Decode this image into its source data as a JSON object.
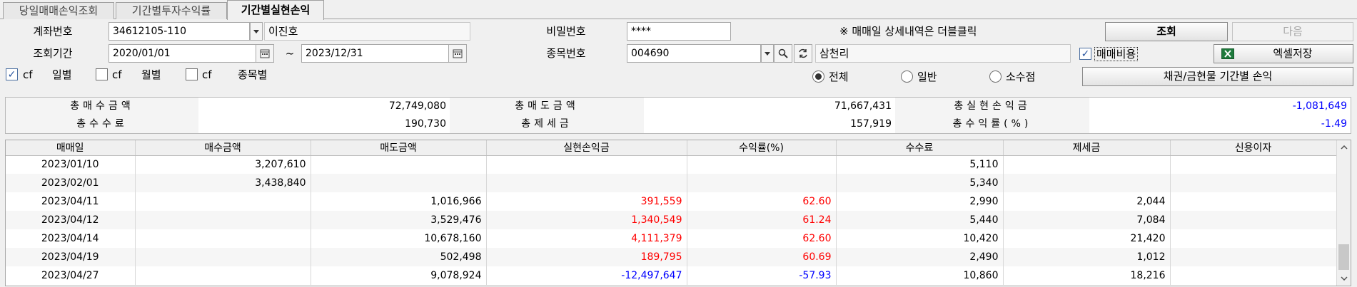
{
  "tabs": [
    {
      "label": "당일매매손익조회"
    },
    {
      "label": "기간별투자수익률"
    },
    {
      "label": "기간별실현손익"
    }
  ],
  "form": {
    "account_label": "계좌번호",
    "account_value": "34612105-110",
    "account_name": "이진호",
    "password_label": "비밀번호",
    "password_value": "****",
    "notice": "※ 매매일 상세내역은 더블클릭",
    "period_label": "조회기간",
    "date_from": "2020/01/01",
    "tilde": "~",
    "date_to": "2023/12/31",
    "stock_label": "종목번호",
    "stock_code": "004690",
    "stock_name": "삼천리",
    "cost_check_label": "매매비용",
    "chk_daily_prefix": "cf",
    "chk_daily_label": "일별",
    "chk_monthly_prefix": "cf",
    "chk_monthly_label": "월별",
    "chk_stock_prefix": "cf",
    "chk_stock_label": "종목별",
    "radio_all": "전체",
    "radio_normal": "일반",
    "radio_fraction": "소수점"
  },
  "buttons": {
    "query": "조회",
    "next": "다음",
    "excel": "엑셀저장",
    "bond": "채권/금현물 기간별 손익"
  },
  "summary": {
    "buy_label": "총매수금액",
    "buy_value": "72,749,080",
    "sell_label": "총매도금액",
    "sell_value": "71,667,431",
    "realized_label": "총실현손익금",
    "realized_value": "-1,081,649",
    "fee_label": "총수수료",
    "fee_value": "190,730",
    "tax_label": "총제세금",
    "tax_value": "157,919",
    "yield_label": "총수익률(%)",
    "yield_value": "-1.49"
  },
  "table": {
    "columns": [
      "매매일",
      "매수금액",
      "매도금액",
      "실현손익금",
      "수익률(%)",
      "수수료",
      "제세금",
      "신용이자"
    ],
    "rows": [
      [
        "2023/01/10",
        "3,207,610",
        "",
        "",
        "",
        "5,110",
        "",
        ""
      ],
      [
        "2023/02/01",
        "3,438,840",
        "",
        "",
        "",
        "5,340",
        "",
        ""
      ],
      [
        "2023/04/11",
        "",
        "1,016,966",
        "391,559",
        "62.60",
        "2,990",
        "2,044",
        ""
      ],
      [
        "2023/04/12",
        "",
        "3,529,476",
        "1,340,549",
        "61.24",
        "5,440",
        "7,084",
        ""
      ],
      [
        "2023/04/14",
        "",
        "10,678,160",
        "4,111,379",
        "62.60",
        "10,420",
        "21,420",
        ""
      ],
      [
        "2023/04/19",
        "",
        "502,498",
        "189,795",
        "60.69",
        "2,490",
        "1,012",
        ""
      ],
      [
        "2023/04/27",
        "",
        "9,078,924",
        "-12,497,647",
        "-57.93",
        "10,860",
        "18,216",
        ""
      ]
    ]
  },
  "colors": {
    "positive": "#ff0000",
    "negative": "#0000ff"
  }
}
